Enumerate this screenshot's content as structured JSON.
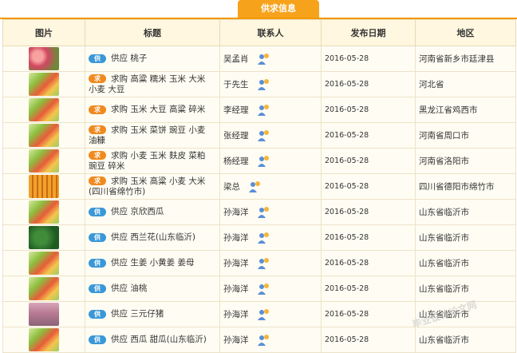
{
  "tab": {
    "label": "供求信息"
  },
  "columns": {
    "image": "图片",
    "title": "标题",
    "contact": "联系人",
    "date": "发布日期",
    "region": "地区"
  },
  "badges": {
    "qiu": "求",
    "gong": "供"
  },
  "rows": [
    {
      "thumb": "peach",
      "type": "gong",
      "title": "供应 桃子",
      "contact": "吴孟肖",
      "date": "2016-05-28",
      "region": "河南省新乡市廷津县"
    },
    {
      "thumb": "veg",
      "type": "qiu",
      "title": "求购 高粱 糯米 玉米 大米 小麦 大豆",
      "contact": "于先生",
      "date": "2016-05-28",
      "region": "河北省"
    },
    {
      "thumb": "veg",
      "type": "qiu",
      "title": "求购 玉米 大豆 高粱 碎米",
      "contact": "李经理",
      "date": "2016-05-28",
      "region": "黑龙江省鸡西市"
    },
    {
      "thumb": "veg",
      "type": "qiu",
      "title": "求购 玉米 菜饼 豌豆 小麦 油糠",
      "contact": "张经理",
      "date": "2016-05-28",
      "region": "河南省周口市"
    },
    {
      "thumb": "veg",
      "type": "qiu",
      "title": "求购 小麦 玉米 麸皮 菜粕 豌豆 碎米",
      "contact": "杨经理",
      "date": "2016-05-28",
      "region": "河南省洛阳市"
    },
    {
      "thumb": "corn",
      "type": "qiu",
      "title": "求购 玉米 高粱 小麦 大米 (四川省绵竹市)",
      "contact": "梁总",
      "date": "2016-05-28",
      "region": "四川省德阳市绵竹市"
    },
    {
      "thumb": "veg",
      "type": "gong",
      "title": "供应 京欣西瓜",
      "contact": "孙海洋",
      "date": "2016-05-28",
      "region": "山东省临沂市"
    },
    {
      "thumb": "broc",
      "type": "gong",
      "title": "供应 西兰花(山东临沂)",
      "contact": "孙海洋",
      "date": "2016-05-28",
      "region": "山东省临沂市"
    },
    {
      "thumb": "veg",
      "type": "gong",
      "title": "供应 生姜 小黄姜 姜母",
      "contact": "孙海洋",
      "date": "2016-05-28",
      "region": "山东省临沂市"
    },
    {
      "thumb": "veg",
      "type": "gong",
      "title": "供应 油桃",
      "contact": "孙海洋",
      "date": "2016-05-28",
      "region": "山东省临沂市"
    },
    {
      "thumb": "pig",
      "type": "gong",
      "title": "供应 三元仔猪",
      "contact": "孙海洋",
      "date": "2016-05-28",
      "region": "山东省临沂市"
    },
    {
      "thumb": "veg",
      "type": "gong",
      "title": "供应 西瓜 甜瓜(山东临沂)",
      "contact": "孙海洋",
      "date": "2016-05-28",
      "region": "山东省临沂市"
    }
  ],
  "watermark": "毕业设计论文网"
}
